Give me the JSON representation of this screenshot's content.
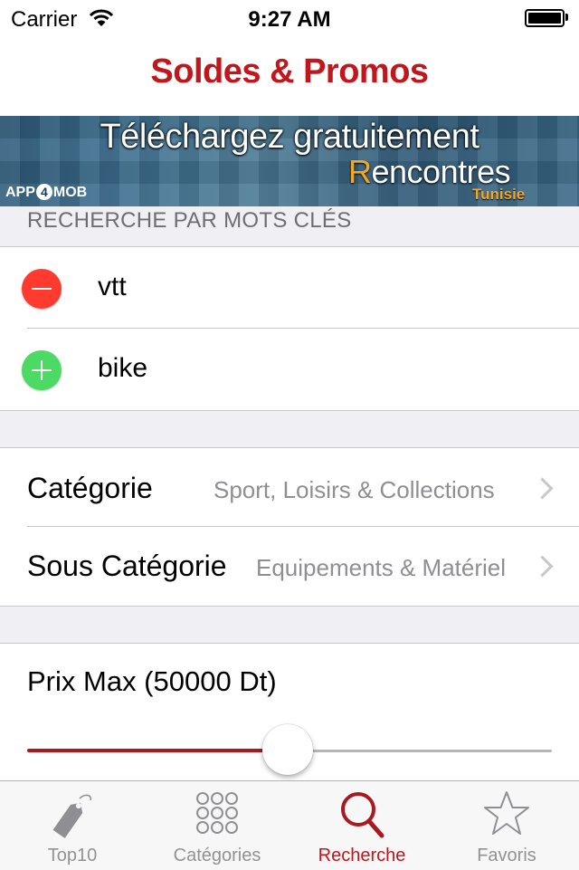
{
  "status_bar": {
    "carrier": "Carrier",
    "time": "9:27 AM"
  },
  "nav": {
    "title": "Soldes & Promos"
  },
  "banner": {
    "headline": "Téléchargez gratuitement",
    "app_r": "R",
    "app_rest": "encontres",
    "country": "Tunisie",
    "logo_a": "APP",
    "logo_4": "4",
    "logo_b": "MOB"
  },
  "keywords": {
    "header": "RECHERCHE PAR MOTS CLÉS",
    "items": [
      {
        "text": "vtt",
        "icon": "minus-icon",
        "color": "#ff3b30"
      },
      {
        "text": "bike",
        "icon": "plus-icon",
        "color": "#4cd964"
      }
    ]
  },
  "filters": {
    "category": {
      "label": "Catégorie",
      "value": "Sport, Loisirs & Collections"
    },
    "subcategory": {
      "label": "Sous Catégorie",
      "value": "Equipements & Matériel"
    }
  },
  "price": {
    "label": "Prix Max (50000 Dt)",
    "slider_fraction": 0.5
  },
  "tabs": [
    {
      "label": "Top10",
      "icon": "tag-icon",
      "active": false
    },
    {
      "label": "Catégories",
      "icon": "grid-icon",
      "active": false
    },
    {
      "label": "Recherche",
      "icon": "search-icon",
      "active": true
    },
    {
      "label": "Favoris",
      "icon": "star-icon",
      "active": false
    }
  ],
  "colors": {
    "accent": "#c0161c",
    "slider_fill": "#a71a1f",
    "remove": "#ff3b30",
    "add": "#4cd964"
  }
}
